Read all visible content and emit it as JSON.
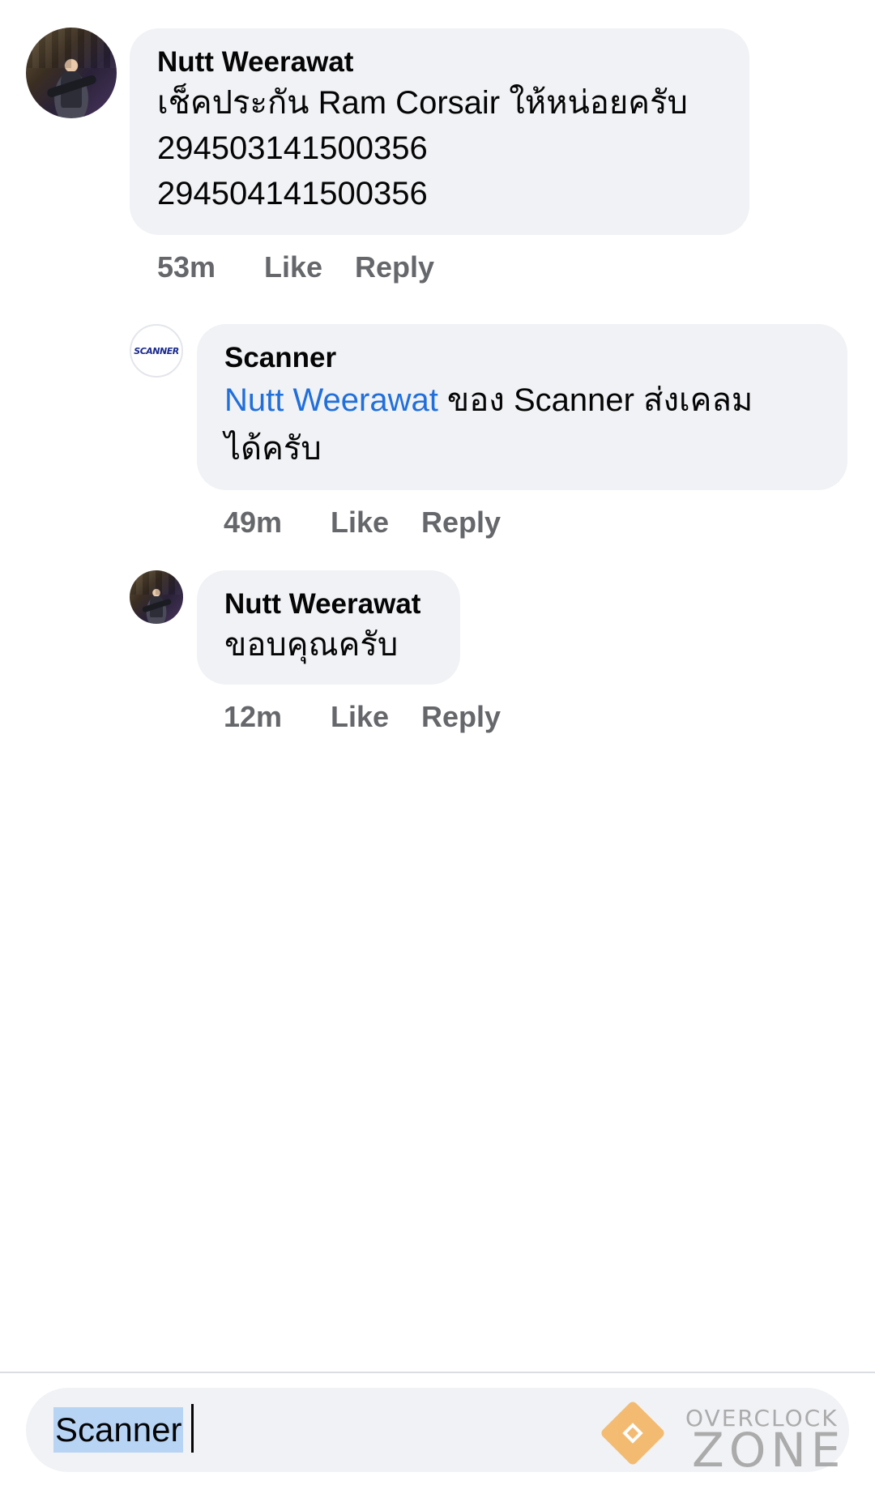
{
  "comments": [
    {
      "author": "Nutt Weerawat",
      "lines": [
        "เช็คประกัน Ram Corsair ให้หน่อยครับ",
        "294503141500356",
        "294504141500356"
      ],
      "time": "53m",
      "like_label": "Like",
      "reply_label": "Reply",
      "avatar": "user-photo-avatar"
    },
    {
      "author": "Scanner",
      "mention": "Nutt Weerawat",
      "text_after_mention": " ของ Scanner ส่งเคลม",
      "text_line2": "ได้ครับ",
      "avatar_logo_text": "SCANNER",
      "time": "49m",
      "like_label": "Like",
      "reply_label": "Reply"
    },
    {
      "author": "Nutt Weerawat",
      "text": "ขอบคุณครับ",
      "time": "12m",
      "like_label": "Like",
      "reply_label": "Reply",
      "avatar": "user-photo-avatar"
    }
  ],
  "composer": {
    "value": "Scanner"
  },
  "watermark": {
    "line1": "OVERCLOCK",
    "line2": "ZONE"
  },
  "colors": {
    "bubble_bg": "#f0f2f5",
    "mention": "#216fdb",
    "meta_text": "#65676b",
    "watermark_accent": "#f4b25a"
  }
}
